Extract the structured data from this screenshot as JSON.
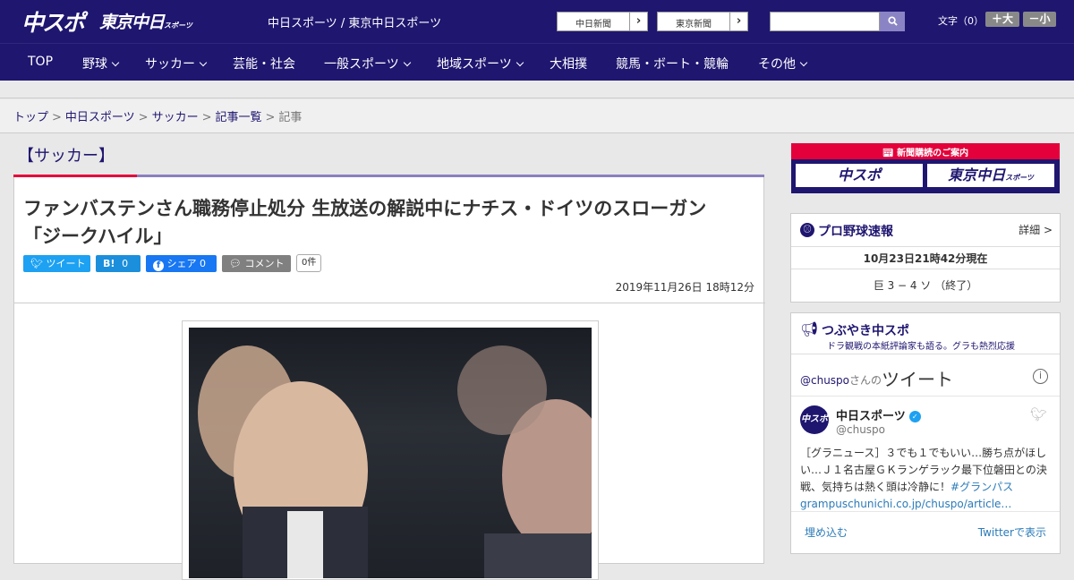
{
  "header": {
    "logo_main": "中スポ",
    "logo_tokyo": "東京中日",
    "logo_tokyo_small": "スポーツ",
    "site_links": "中日スポーツ / 東京中日スポーツ",
    "newspaper_buttons": [
      "中日新聞",
      "東京新聞"
    ],
    "search": {
      "placeholder": ""
    },
    "text_size_label": "文字（0）",
    "text_size_up": "＋大",
    "text_size_down": "－小"
  },
  "nav": {
    "items": [
      {
        "label": "TOP",
        "dropdown": false
      },
      {
        "label": "野球",
        "dropdown": true
      },
      {
        "label": "サッカー",
        "dropdown": true
      },
      {
        "label": "芸能・社会",
        "dropdown": false
      },
      {
        "label": "一般スポーツ",
        "dropdown": true
      },
      {
        "label": "地域スポーツ",
        "dropdown": true
      },
      {
        "label": "大相撲",
        "dropdown": false
      },
      {
        "label": "競馬・ボート・競輪",
        "dropdown": false
      },
      {
        "label": "その他",
        "dropdown": true
      }
    ]
  },
  "breadcrumb": [
    "トップ",
    "中日スポーツ",
    "サッカー",
    "記事一覧",
    "記事"
  ],
  "article": {
    "category": "【サッカー】",
    "headline_line1": "ファンバステンさん職務停止処分 生放送の解説中にナチス・ドイツのスローガン",
    "headline_line2": "「ジークハイル」",
    "share": {
      "tweet": "ツイート",
      "hatena_label": "B!",
      "hatena_count": "0",
      "facebook_label": "シェア",
      "facebook_count": "0",
      "comment": "コメント",
      "comment_count": "0件"
    },
    "date": "2019年11月26日 18時12分"
  },
  "sidebar": {
    "banner_title": "新聞購読のご案内",
    "banner_left": "中スポ",
    "banner_right": "東京中日",
    "banner_right_small": "スポーツ",
    "baseball": {
      "title": "プロ野球速報",
      "detail": "詳細 >",
      "time": "10月23日21時42分現在",
      "score": "巨 3 − 4 ソ （終了）"
    },
    "tsubuyaki": {
      "title": "つぶやき中スポ",
      "subtitle": "ドラ観戦の本紙評論家も語る。グラも熱烈応援",
      "tweets_prefix": "@chuspo",
      "tweets_mid": "さんの",
      "tweets_title": "ツイート",
      "name": "中日スポーツ",
      "handle": "@chuspo",
      "avatar": "中スポ",
      "body": "［グラニュース］３でも１でもいい…勝ち点がほしい…Ｊ１名古屋ＧＫランゲラック最下位磐田との決戦、気持ちは熱く頭は冷静に！",
      "hashtag": "#グランパス",
      "link": "grampuschunichi.co.jp/chuspo/article…",
      "embed": "埋め込む",
      "view_on": "Twitterで表示"
    }
  }
}
